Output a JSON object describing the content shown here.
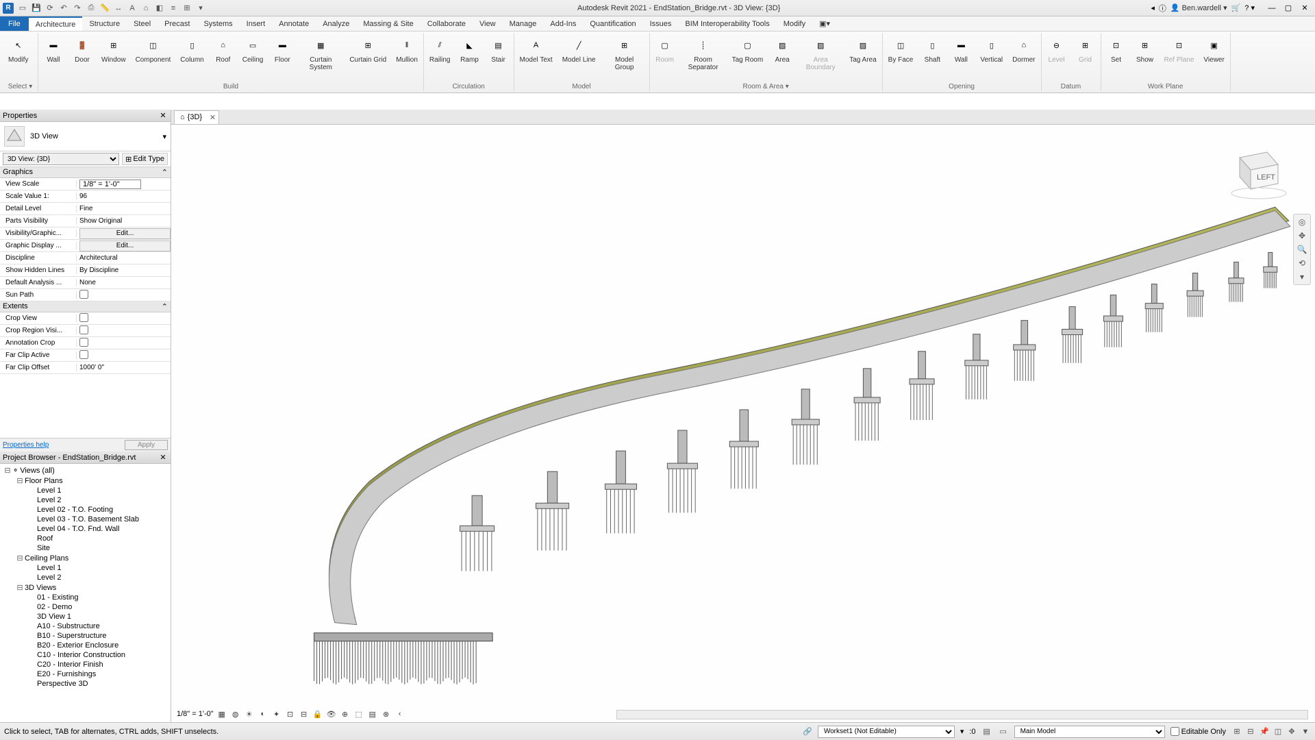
{
  "title": "Autodesk Revit 2021 - EndStation_Bridge.rvt - 3D View: {3D}",
  "user": "Ben.wardell",
  "menu": {
    "file": "File",
    "tabs": [
      "Architecture",
      "Structure",
      "Steel",
      "Precast",
      "Systems",
      "Insert",
      "Annotate",
      "Analyze",
      "Massing & Site",
      "Collaborate",
      "View",
      "Manage",
      "Add-Ins",
      "Quantification",
      "Issues",
      "BIM Interoperability Tools",
      "Modify"
    ]
  },
  "ribbon": {
    "modify": "Modify",
    "select": "Select ▾",
    "build": {
      "label": "Build",
      "items": [
        "Wall",
        "Door",
        "Window",
        "Component",
        "Column",
        "Roof",
        "Ceiling",
        "Floor",
        "Curtain System",
        "Curtain Grid",
        "Mullion"
      ]
    },
    "circulation": {
      "label": "Circulation",
      "items": [
        "Railing",
        "Ramp",
        "Stair"
      ]
    },
    "model": {
      "label": "Model",
      "items": [
        "Model Text",
        "Model Line",
        "Model Group"
      ]
    },
    "room": {
      "label": "Room & Area ▾",
      "items": [
        "Room",
        "Room Separator",
        "Tag Room",
        "Area",
        "Area Boundary",
        "Tag Area"
      ]
    },
    "opening": {
      "label": "Opening",
      "items": [
        "By Face",
        "Shaft",
        "Wall",
        "Vertical",
        "Dormer"
      ]
    },
    "datum": {
      "label": "Datum",
      "items": [
        "Level",
        "Grid"
      ]
    },
    "workplane": {
      "label": "Work Plane",
      "items": [
        "Set",
        "Show",
        "Ref Plane",
        "Viewer"
      ]
    }
  },
  "properties": {
    "title": "Properties",
    "type": "3D View",
    "instance": "3D View: {3D}",
    "edit_type": "Edit Type",
    "graphics": "Graphics",
    "rows": [
      {
        "k": "View Scale",
        "v": "1/8\" = 1'-0\"",
        "boxed": true
      },
      {
        "k": "Scale Value    1:",
        "v": "96"
      },
      {
        "k": "Detail Level",
        "v": "Fine"
      },
      {
        "k": "Parts Visibility",
        "v": "Show Original"
      },
      {
        "k": "Visibility/Graphic...",
        "v": "Edit...",
        "btn": true
      },
      {
        "k": "Graphic Display ...",
        "v": "Edit...",
        "btn": true
      },
      {
        "k": "Discipline",
        "v": "Architectural"
      },
      {
        "k": "Show Hidden Lines",
        "v": "By Discipline"
      },
      {
        "k": "Default Analysis ...",
        "v": "None"
      },
      {
        "k": "Sun Path",
        "v": "",
        "cb": true
      }
    ],
    "extents": "Extents",
    "ext_rows": [
      {
        "k": "Crop View",
        "cb": true
      },
      {
        "k": "Crop Region Visi...",
        "cb": true
      },
      {
        "k": "Annotation Crop",
        "cb": true
      },
      {
        "k": "Far Clip Active",
        "cb": true
      },
      {
        "k": "Far Clip Offset",
        "v": "1000'  0\""
      }
    ],
    "help": "Properties help",
    "apply": "Apply"
  },
  "browser": {
    "title": "Project Browser - EndStation_Bridge.rvt",
    "root": "Views (all)",
    "floor_plans": "Floor Plans",
    "fp": [
      "Level 1",
      "Level 2",
      "Level 02 - T.O. Footing",
      "Level 03 - T.O. Basement Slab",
      "Level 04 - T.O. Fnd. Wall",
      "Roof",
      "Site"
    ],
    "ceiling_plans": "Ceiling Plans",
    "cp": [
      "Level 1",
      "Level 2"
    ],
    "views3d": "3D Views",
    "v3": [
      "01 - Existing",
      "02 - Demo",
      "3D View 1",
      "A10 - Substructure",
      "B10 - Superstructure",
      "B20 - Exterior Enclosure",
      "C10 - Interior Construction",
      "C20 - Interior Finish",
      "E20 - Furnishings",
      "Perspective 3D"
    ]
  },
  "view": {
    "tab": "{3D}",
    "cube_face": "LEFT",
    "scale": "1/8\" = 1'-0\""
  },
  "status": {
    "hint": "Click to select, TAB for alternates, CTRL adds, SHIFT unselects.",
    "workset": "Workset1 (Not Editable)",
    "sel": ":0",
    "model": "Main Model",
    "editable": "Editable Only"
  }
}
